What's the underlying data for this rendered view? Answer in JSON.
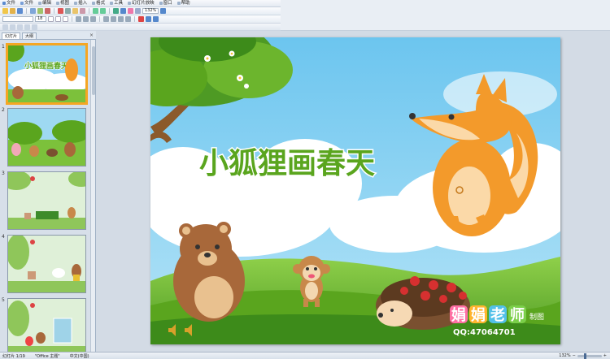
{
  "menubar": {
    "items": [
      {
        "label": "文件",
        "color": "#5b8bd0"
      },
      {
        "label": "文件",
        "color": "#7aa0d8"
      },
      {
        "label": "编辑",
        "color": "#9db2cc"
      },
      {
        "label": "视图",
        "color": "#9db2cc"
      },
      {
        "label": "插入",
        "color": "#9db2cc"
      },
      {
        "label": "格式",
        "color": "#9db2cc"
      },
      {
        "label": "工具",
        "color": "#9db2cc"
      },
      {
        "label": "幻灯片放映",
        "color": "#9db2cc"
      },
      {
        "label": "窗口",
        "color": "#9db2cc"
      },
      {
        "label": "帮助",
        "color": "#9db2cc"
      }
    ]
  },
  "toolbar": {
    "font_size_value": "18",
    "zoom_value": "132%"
  },
  "pane": {
    "tabs": [
      "幻灯片",
      "大纲"
    ],
    "close_glyph": "×",
    "thumbnails": [
      {
        "num": "1",
        "selected": true
      },
      {
        "num": "2",
        "selected": false
      },
      {
        "num": "3",
        "selected": false
      },
      {
        "num": "4",
        "selected": false
      },
      {
        "num": "5",
        "selected": false
      }
    ]
  },
  "slide": {
    "title": "小狐狸画春天",
    "signature": "娟娟老师",
    "signature_suffix": "制图",
    "qq": "QQ:47064701",
    "colors": {
      "sky": "#8fd3f4",
      "grass": "#7cc13b",
      "grass_dark": "#4e9a24",
      "fox": "#f39a2b",
      "bear": "#a8683a",
      "title_green": "#5aa51e"
    }
  },
  "statusbar": {
    "slide_info": "幻灯片 1/19",
    "theme": "\"Office 主题\"",
    "language": "中文(中国)",
    "zoom": "132%"
  }
}
